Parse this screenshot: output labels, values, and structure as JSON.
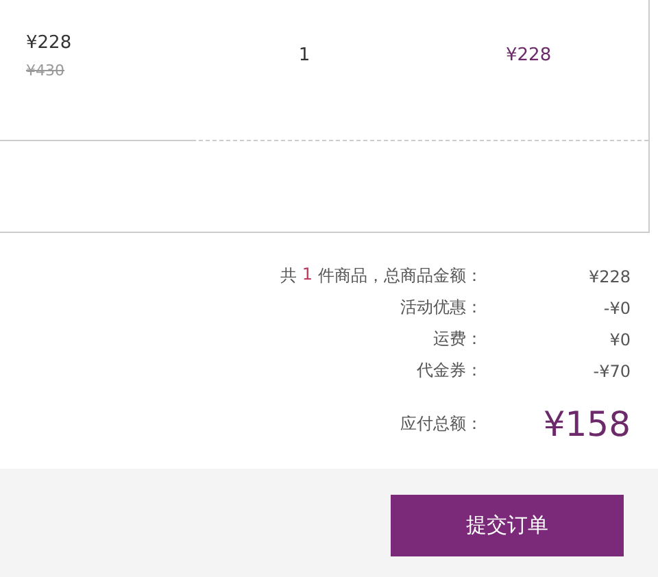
{
  "order_item": {
    "unit_price": "¥228",
    "original_price": "¥430",
    "quantity": "1",
    "subtotal": "¥228"
  },
  "summary": {
    "count_prefix": "共",
    "count": "1",
    "count_suffix": "件商品，总商品金额：",
    "rows": [
      {
        "label": "活动优惠：",
        "value": "-¥0"
      },
      {
        "label": "运费：",
        "value": "¥0"
      },
      {
        "label": "代金券：",
        "value": "-¥70"
      }
    ],
    "goods_total": "¥228",
    "payable_label": "应付总额：",
    "payable_value": "¥158"
  },
  "submit_button": "提交订单"
}
